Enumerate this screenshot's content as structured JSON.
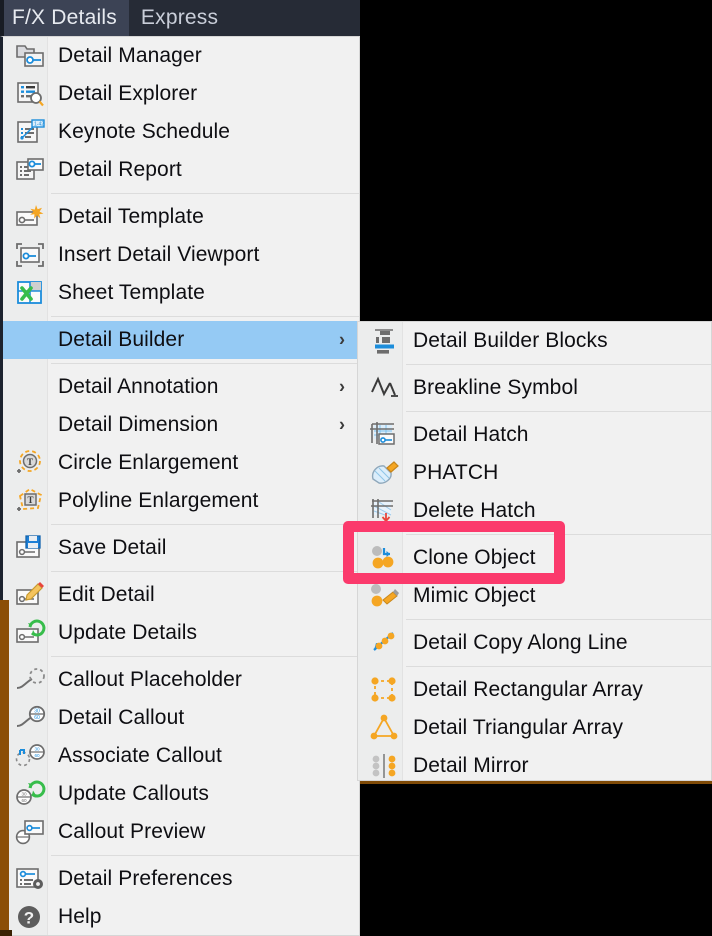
{
  "menubar": {
    "tabs": [
      {
        "label": "F/X Details",
        "active": true
      },
      {
        "label": "Express",
        "active": false
      }
    ]
  },
  "colors": {
    "menubar_bg": "#262b36",
    "menubar_active_tab": "#3c4355",
    "menu_bg": "#f1f1f1",
    "menu_gutter": "#eceded",
    "selection_blue": "#95caf4",
    "annotation_pink": "#fb3a6c",
    "icon_blue": "#1c8ddb",
    "icon_orange": "#f5a623",
    "icon_gray": "#6d6d6d",
    "icon_green": "#37bd4b",
    "canvas_black": "#000000",
    "window_edge_orange": "#8b4f07"
  },
  "menu": {
    "name": "F/X Details menu",
    "groups": [
      {
        "items": [
          {
            "label": "Detail Manager",
            "icon": "detail-manager-icon",
            "submenu": false
          },
          {
            "label": "Detail Explorer",
            "icon": "detail-explorer-icon",
            "submenu": false
          },
          {
            "label": "Keynote Schedule",
            "icon": "keynote-schedule-icon",
            "submenu": false
          },
          {
            "label": "Detail Report",
            "icon": "detail-report-icon",
            "submenu": false
          }
        ]
      },
      {
        "items": [
          {
            "label": "Detail Template",
            "icon": "detail-template-icon",
            "submenu": false
          },
          {
            "label": "Insert Detail Viewport",
            "icon": "insert-detail-viewport-icon",
            "submenu": false
          },
          {
            "label": "Sheet Template",
            "icon": "sheet-template-icon",
            "submenu": false
          }
        ]
      },
      {
        "items": [
          {
            "label": "Detail Builder",
            "icon": "",
            "submenu": true,
            "selected": true
          }
        ]
      },
      {
        "items": [
          {
            "label": "Detail Annotation",
            "icon": "",
            "submenu": true
          },
          {
            "label": "Detail Dimension",
            "icon": "",
            "submenu": true
          },
          {
            "label": "Circle Enlargement",
            "icon": "circle-enlargement-icon",
            "submenu": false
          },
          {
            "label": "Polyline Enlargement",
            "icon": "polyline-enlargement-icon",
            "submenu": false
          }
        ]
      },
      {
        "items": [
          {
            "label": "Save Detail",
            "icon": "save-detail-icon",
            "submenu": false
          }
        ]
      },
      {
        "items": [
          {
            "label": "Edit Detail",
            "icon": "edit-detail-icon",
            "submenu": false
          },
          {
            "label": "Update Details",
            "icon": "update-details-icon",
            "submenu": false
          }
        ]
      },
      {
        "items": [
          {
            "label": "Callout Placeholder",
            "icon": "callout-placeholder-icon",
            "submenu": false
          },
          {
            "label": "Detail Callout",
            "icon": "detail-callout-icon",
            "submenu": false
          },
          {
            "label": "Associate Callout",
            "icon": "associate-callout-icon",
            "submenu": false
          },
          {
            "label": "Update Callouts",
            "icon": "update-callouts-icon",
            "submenu": false
          },
          {
            "label": "Callout Preview",
            "icon": "callout-preview-icon",
            "submenu": false
          }
        ]
      },
      {
        "items": [
          {
            "label": "Detail Preferences",
            "icon": "detail-preferences-icon",
            "submenu": false
          },
          {
            "label": "Help",
            "icon": "help-icon",
            "submenu": false
          }
        ]
      }
    ]
  },
  "submenu": {
    "name": "Detail Builder submenu",
    "groups": [
      {
        "items": [
          {
            "label": "Detail Builder Blocks",
            "icon": "detail-builder-blocks-icon"
          }
        ]
      },
      {
        "items": [
          {
            "label": "Breakline Symbol",
            "icon": "breakline-symbol-icon"
          }
        ]
      },
      {
        "items": [
          {
            "label": "Detail Hatch",
            "icon": "detail-hatch-icon"
          },
          {
            "label": "PHATCH",
            "icon": "phatch-icon"
          },
          {
            "label": "Delete Hatch",
            "icon": "delete-hatch-icon"
          }
        ]
      },
      {
        "items": [
          {
            "label": "Clone Object",
            "icon": "clone-object-icon",
            "highlighted": true
          },
          {
            "label": "Mimic Object",
            "icon": "mimic-object-icon"
          }
        ]
      },
      {
        "items": [
          {
            "label": "Detail Copy Along Line",
            "icon": "detail-copy-along-line-icon"
          }
        ]
      },
      {
        "items": [
          {
            "label": "Detail Rectangular Array",
            "icon": "detail-rectangular-array-icon"
          },
          {
            "label": "Detail Triangular Array",
            "icon": "detail-triangular-array-icon"
          },
          {
            "label": "Detail Mirror",
            "icon": "detail-mirror-icon"
          }
        ]
      }
    ]
  },
  "annotation": {
    "target_label": "Clone Object",
    "shape": "rounded-rectangle-outline"
  }
}
